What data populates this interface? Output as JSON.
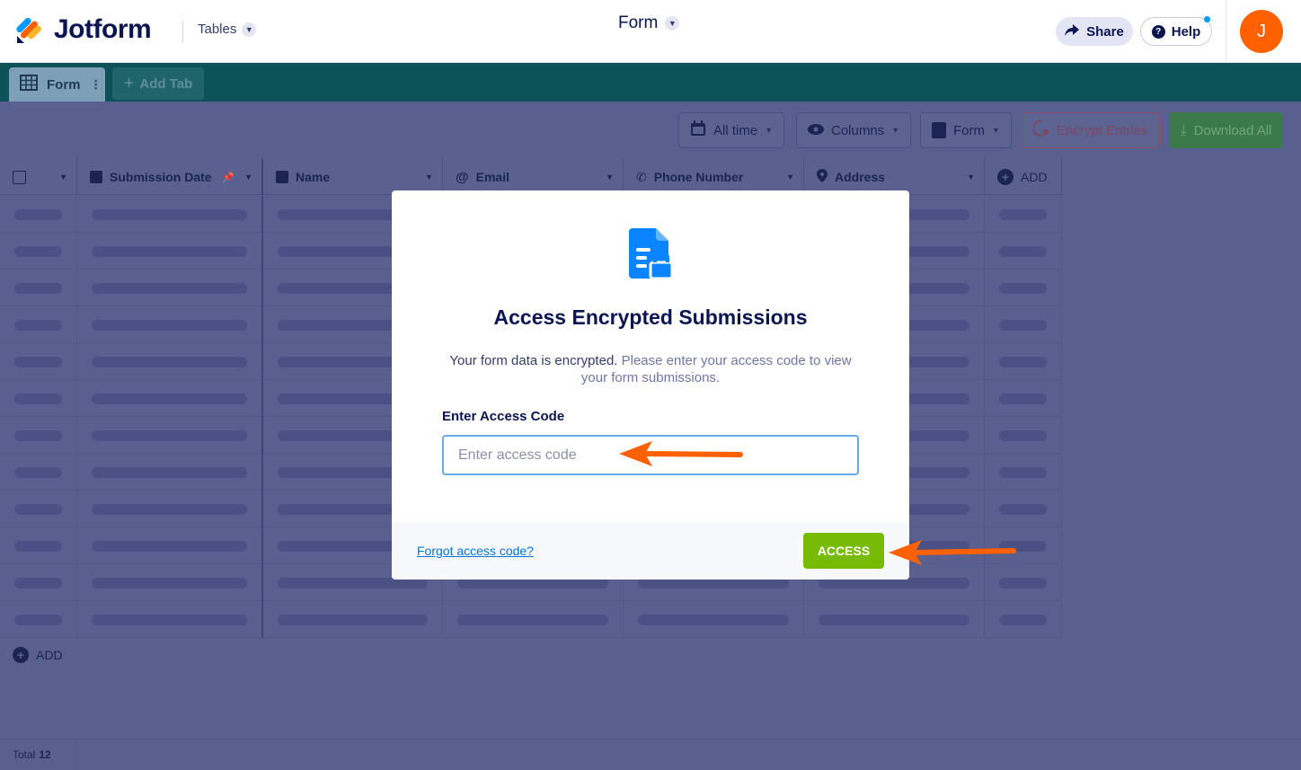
{
  "header": {
    "logo_text": "Jotform",
    "tables_label": "Tables",
    "form_title": "Form",
    "share_label": "Share",
    "help_label": "Help",
    "avatar_initial": "J"
  },
  "tabs": {
    "active_tab_label": "Form",
    "add_tab_label": "Add Tab"
  },
  "toolbar": {
    "date_filter": "All time",
    "columns": "Columns",
    "form_view": "Form",
    "encrypt": "Encrypt Entries",
    "download": "Download All"
  },
  "table": {
    "columns": [
      "Submission Date",
      "Name",
      "Email",
      "Phone Number",
      "Address"
    ],
    "add_column_label": "ADD",
    "add_row_label": "ADD",
    "total_label": "Total",
    "total_count": "12"
  },
  "modal": {
    "title": "Access Encrypted Submissions",
    "desc_part1": "Your form data is encrypted.",
    "desc_part2": "Please enter your access code to view your form submissions.",
    "code_label": "Enter Access Code",
    "code_placeholder": "Enter access code",
    "code_value": "",
    "forgot_link": "Forgot access code?",
    "access_button": "ACCESS"
  },
  "colors": {
    "brand_navy": "#0a1551",
    "access_green": "#78bb07",
    "avatar_orange": "#ff6100",
    "annotation_arrow": "#ff6100",
    "tabbar_teal": "#0d5259"
  }
}
